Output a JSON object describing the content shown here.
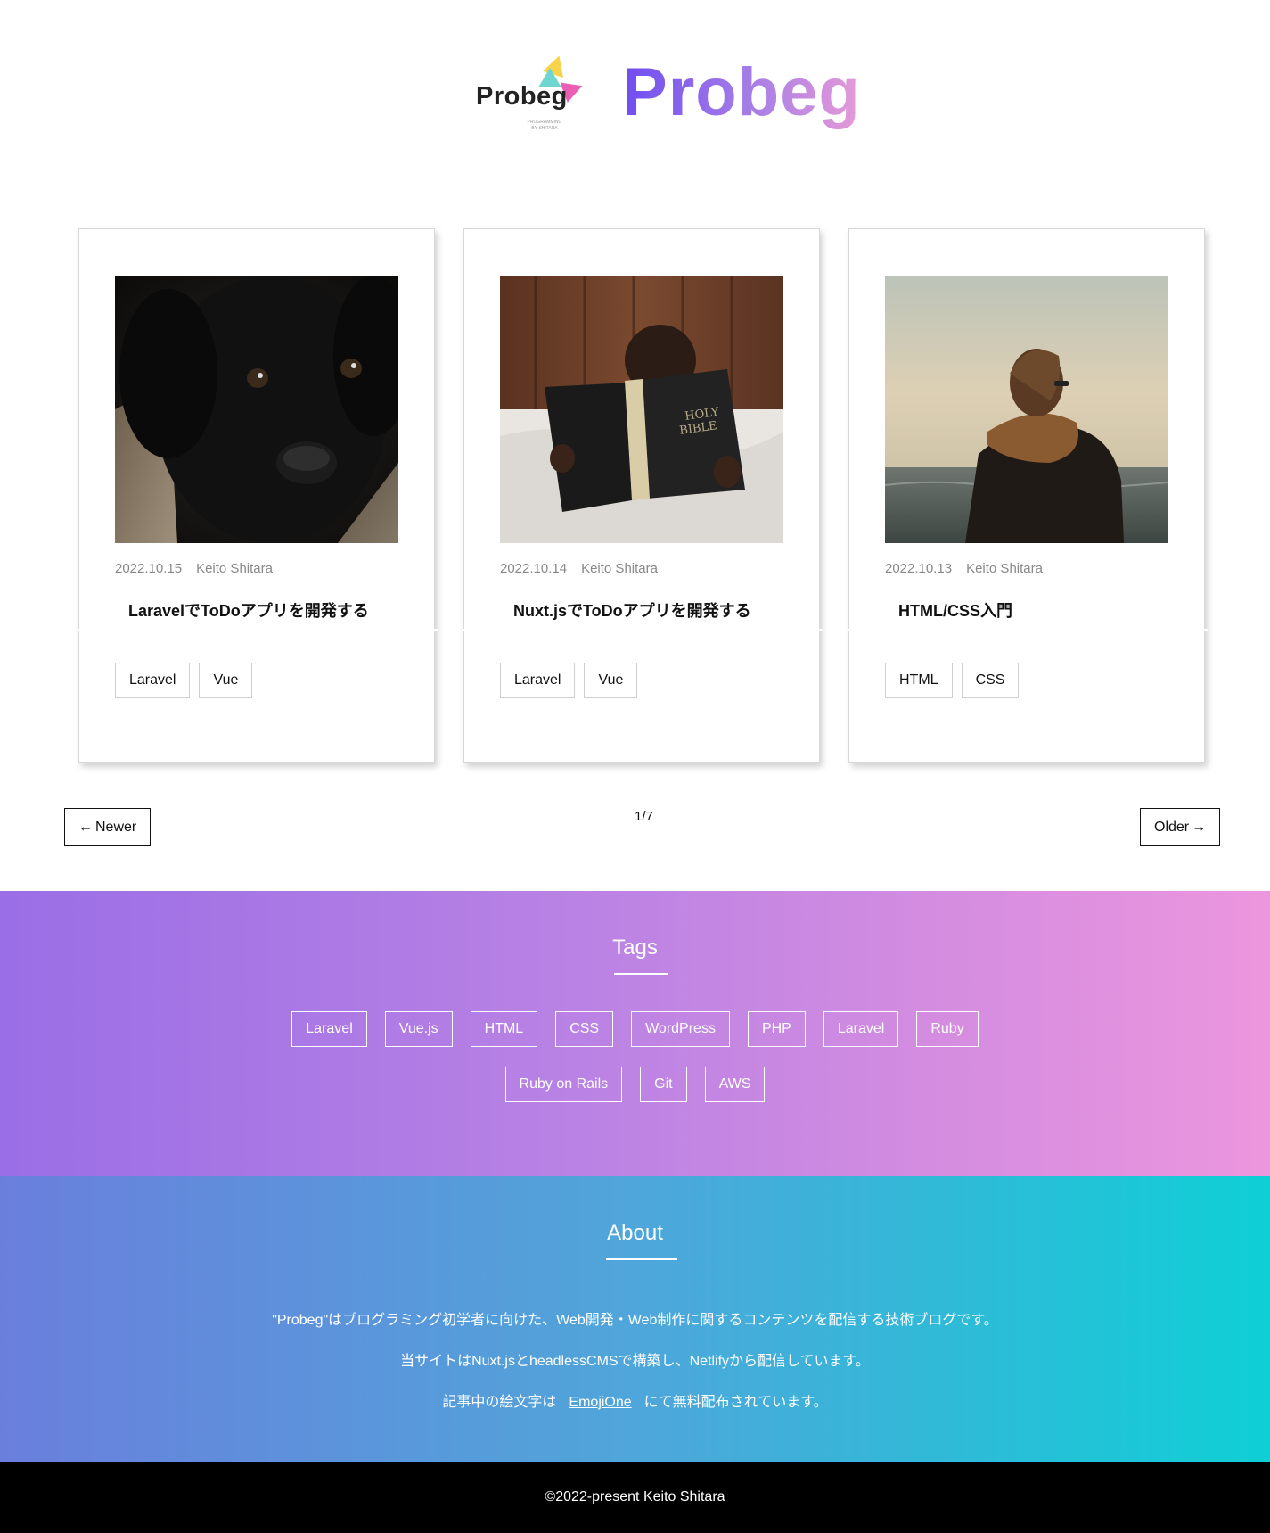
{
  "header": {
    "logo_word": "Probeg",
    "logo_sub": "PROGRAMMING BY SHITARA",
    "title": "Probeg"
  },
  "posts": [
    {
      "date": "2022.10.15",
      "author": "Keito Shitara",
      "title": "LaravelでToDoアプリを開発する",
      "tags": [
        "Laravel",
        "Vue"
      ],
      "image": "black-puppy"
    },
    {
      "date": "2022.10.14",
      "author": "Keito Shitara",
      "title": "Nuxt.jsでToDoアプリを開発する",
      "tags": [
        "Laravel",
        "Vue"
      ],
      "image": "child-reading-bible"
    },
    {
      "date": "2022.10.13",
      "author": "Keito Shitara",
      "title": "HTML/CSS入門",
      "tags": [
        "HTML",
        "CSS"
      ],
      "image": "person-by-sea"
    }
  ],
  "pagination": {
    "newer": "Newer",
    "older": "Older",
    "count": "1/7"
  },
  "tags_section": {
    "title": "Tags",
    "row1": [
      "Laravel",
      "Vue.js",
      "HTML",
      "CSS",
      "WordPress",
      "PHP",
      "Laravel",
      "Ruby"
    ],
    "row2": [
      "Ruby on Rails",
      "Git",
      "AWS"
    ]
  },
  "about": {
    "title": "About",
    "line1": "\"Probeg\"はプログラミング初学者に向けた、Web開発・Web制作に関するコンテンツを配信する技術ブログです。",
    "line2": "当サイトはNuxt.jsとheadlessCMSで構築し、Netlifyから配信しています。",
    "line3_before": "記事中の絵文字は",
    "line3_link": "EmojiOne",
    "line3_after": "にて無料配布されています。"
  },
  "footer": {
    "copyright": "©2022-present Keito Shitara"
  },
  "colors": {
    "tags_gradient": [
      "#9a6ee6",
      "#ec96dd"
    ],
    "about_gradient": [
      "#6a7fdc",
      "#0fcfd6"
    ],
    "brand_gradient": [
      "#6f4df0",
      "#e79ad8"
    ]
  }
}
